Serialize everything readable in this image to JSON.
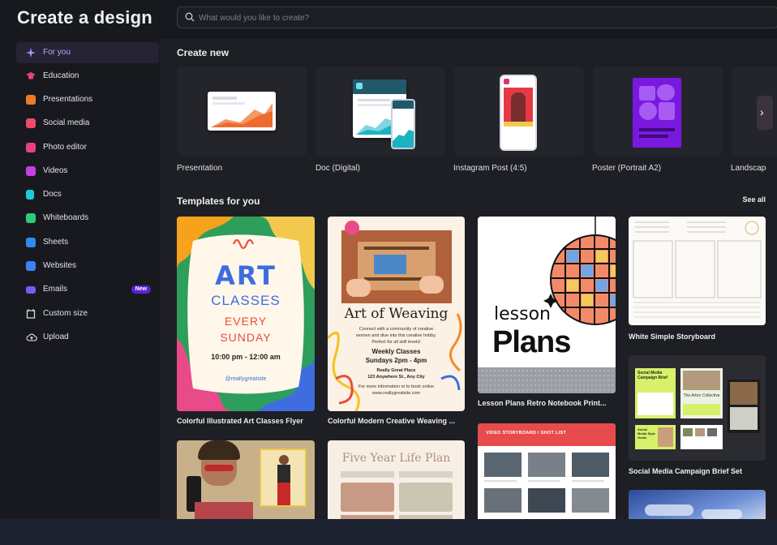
{
  "header": {
    "title": "Create a design",
    "search_placeholder": "What would you like to create?"
  },
  "sidebar": {
    "items": [
      {
        "label": "For you",
        "icon": "sparkle-icon",
        "color": "#8b7bff"
      },
      {
        "label": "Education",
        "icon": "graduation-cap-icon",
        "color": "#e8447a"
      },
      {
        "label": "Presentations",
        "icon": "presentation-icon",
        "color": "#f07a2a"
      },
      {
        "label": "Social media",
        "icon": "heart-icon",
        "color": "#ef4a6a"
      },
      {
        "label": "Photo editor",
        "icon": "camera-icon",
        "color": "#ea3f86"
      },
      {
        "label": "Videos",
        "icon": "video-icon",
        "color": "#c43fe0"
      },
      {
        "label": "Docs",
        "icon": "doc-icon",
        "color": "#21c8d8"
      },
      {
        "label": "Whiteboards",
        "icon": "whiteboard-icon",
        "color": "#2fca7a"
      },
      {
        "label": "Sheets",
        "icon": "sheet-icon",
        "color": "#2d8cf0"
      },
      {
        "label": "Websites",
        "icon": "website-icon",
        "color": "#3b82f6"
      },
      {
        "label": "Emails",
        "icon": "email-icon",
        "color": "#7b5cf0",
        "badge": "New"
      },
      {
        "label": "Custom size",
        "icon": "custom-size-icon",
        "color": "#e3e4ea"
      },
      {
        "label": "Upload",
        "icon": "upload-icon",
        "color": "#e3e4ea"
      }
    ]
  },
  "create_new": {
    "title": "Create new",
    "items": [
      {
        "label": "Presentation"
      },
      {
        "label": "Doc (Digital)"
      },
      {
        "label": "Instagram Post (4:5)"
      },
      {
        "label": "Poster (Portrait A2)"
      },
      {
        "label": "Landscape"
      }
    ]
  },
  "templates": {
    "title": "Templates for you",
    "see_all": "See all",
    "items": [
      {
        "label": "Colorful Illustrated Art Classes Flyer",
        "art": {
          "line1": "ART",
          "line2": "CLASSES",
          "line3": "EVERY",
          "line4": "SUNDAY",
          "time": "10:00 pm - 12:00 am",
          "handle": "@reallygreatsite"
        }
      },
      {
        "label": "Colorful Modern Creative Weaving ...",
        "art": {
          "title": "Art of Weaving",
          "body": "Connect with a community of creative women and dive into this creative hobby. Perfect for all skill levels!",
          "classes": "Weekly Classes",
          "time": "Sundays 2pm - 4pm",
          "place": "Really Great Place",
          "address": "123 Anywhere St., Any City",
          "info": "For more information or to book online",
          "site": "www.reallygreatsite.com"
        }
      },
      {
        "label": "Lesson Plans Retro Notebook Print...",
        "art": {
          "line1": "lesson",
          "line2": "Plans"
        }
      },
      {
        "label": "White Simple Storyboard"
      },
      {
        "label": "Social Media Campaign Brief Set",
        "art": {
          "card1": "Social Media Campaign Brief",
          "card2": "The Arbor Collective",
          "card3": "Social Media Style Guide"
        }
      },
      {
        "label": "",
        "art": {
          "title": "Five Year Life Plan"
        }
      },
      {
        "label": "",
        "art": {
          "title": "VIDEO STORYBOARD / SHOT LIST"
        }
      }
    ]
  }
}
